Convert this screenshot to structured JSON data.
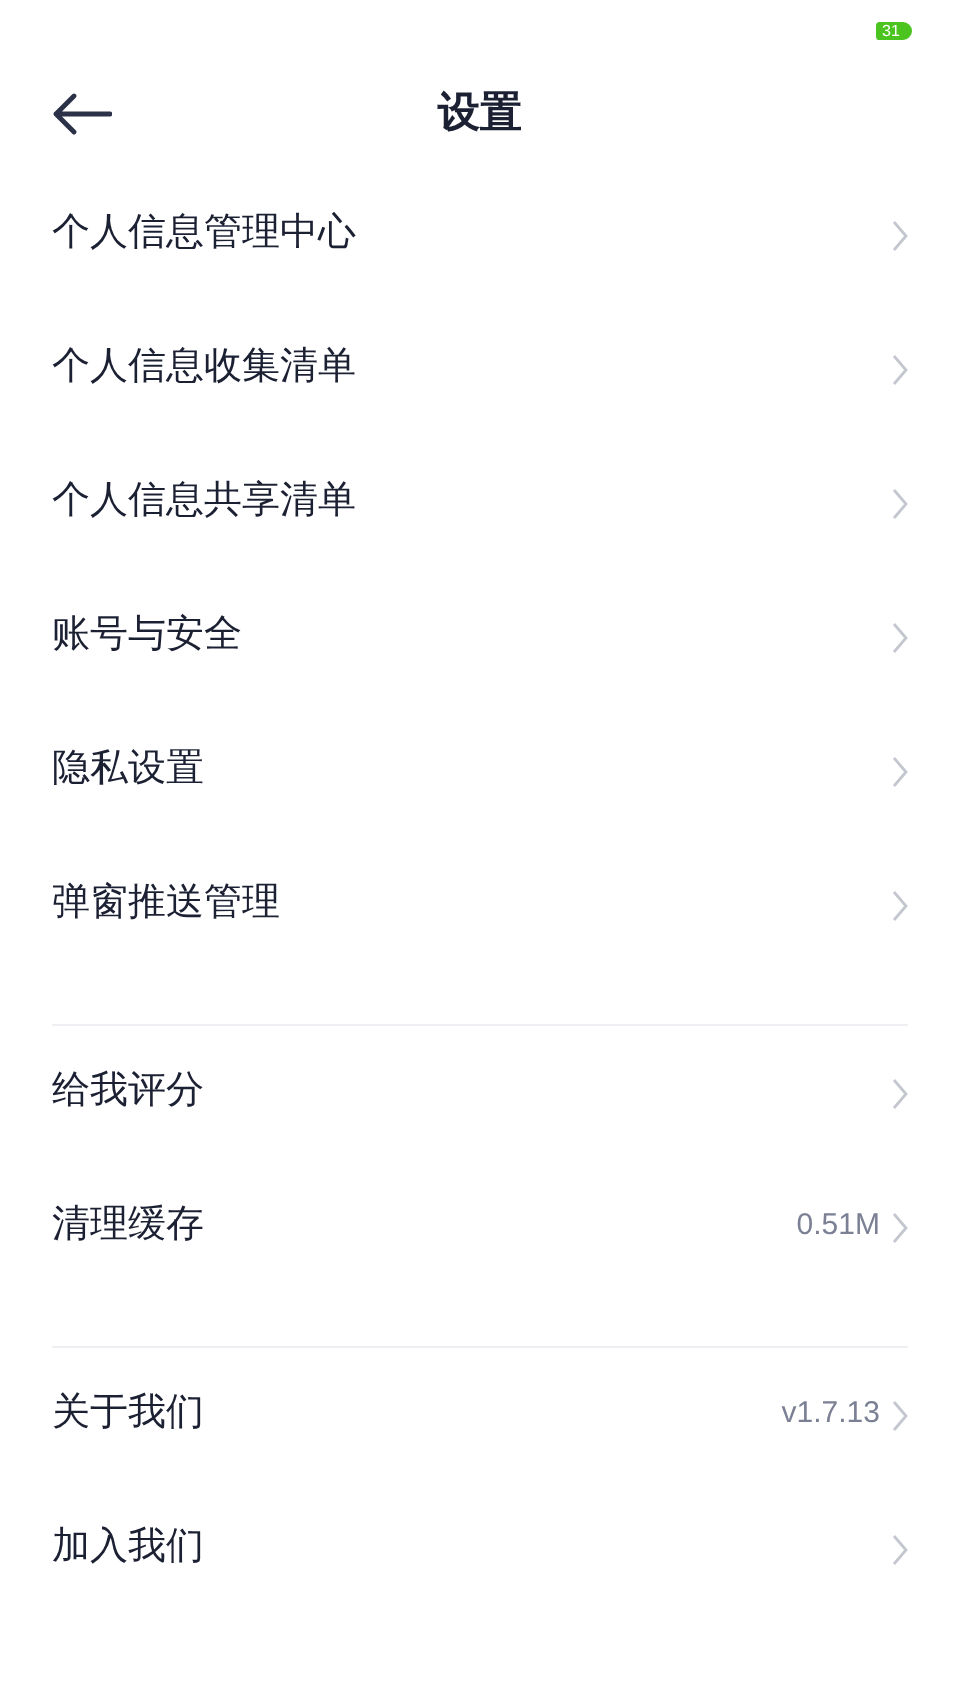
{
  "status_bar": {
    "battery": "31"
  },
  "header": {
    "title": "设置"
  },
  "sections": [
    {
      "items": [
        {
          "label": "个人信息管理中心"
        },
        {
          "label": "个人信息收集清单"
        },
        {
          "label": "个人信息共享清单"
        },
        {
          "label": "账号与安全"
        },
        {
          "label": "隐私设置"
        },
        {
          "label": "弹窗推送管理"
        }
      ]
    },
    {
      "items": [
        {
          "label": "给我评分"
        },
        {
          "label": "清理缓存",
          "value": "0.51M"
        }
      ]
    },
    {
      "items": [
        {
          "label": "关于我们",
          "value": "v1.7.13"
        },
        {
          "label": "加入我们"
        }
      ]
    }
  ]
}
